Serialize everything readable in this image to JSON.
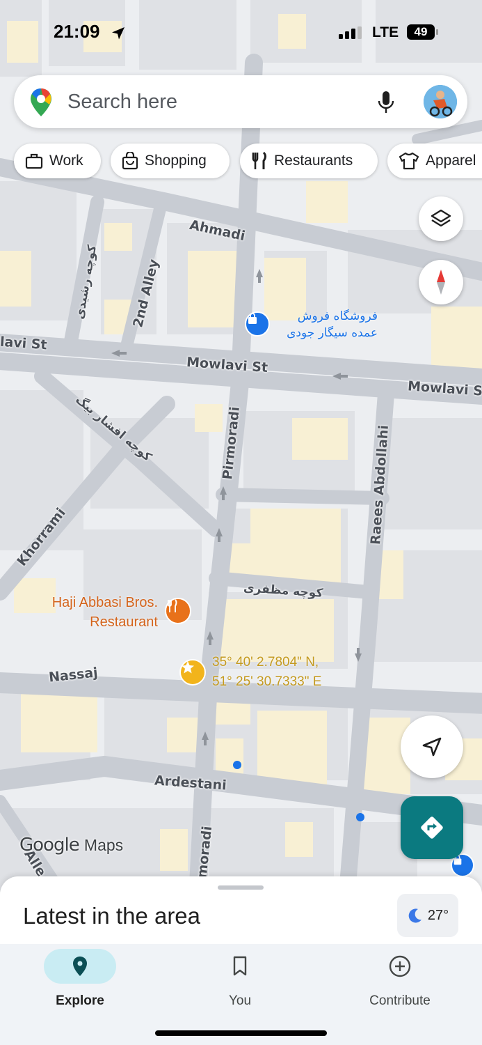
{
  "status_bar": {
    "time": "21:09",
    "carrier": "LTE",
    "battery": "49"
  },
  "search": {
    "placeholder": "Search here"
  },
  "chips": [
    {
      "label": "Work",
      "icon": "briefcase-icon"
    },
    {
      "label": "Shopping",
      "icon": "shopping-bag-icon"
    },
    {
      "label": "Restaurants",
      "icon": "fork-knife-icon"
    },
    {
      "label": "Apparel",
      "icon": "shirt-icon"
    }
  ],
  "map": {
    "streets": [
      "Ahmadi",
      "Mowlavi St",
      "Mowlavi St",
      "Mowlavi S",
      "lavi St",
      "2nd Alley",
      "کوچه رشیدی",
      "کوچه افشار بیگ",
      "Pirmoradi",
      "Raees Abdollahi",
      "Khorrami",
      "کوچه مظفری",
      "Nassaj",
      "Ardestani",
      "irmoradi",
      "Alle"
    ],
    "pois": [
      {
        "name": "فروشگاه فروش عمده سیگار جودی",
        "type": "shopping",
        "color": "#1a73e8"
      },
      {
        "name": "Haji Abbasi Bros. Restaurant",
        "type": "restaurant",
        "color": "#e8711a"
      }
    ],
    "pin": {
      "line1": "35° 40' 2.7804\" N,",
      "line2": "51° 25' 30.7333\" E"
    },
    "attribution_google": "Google",
    "attribution_maps": "Maps"
  },
  "sheet": {
    "title": "Latest in the area",
    "temperature": "27°"
  },
  "nav": [
    {
      "label": "Explore",
      "active": true
    },
    {
      "label": "You",
      "active": false
    },
    {
      "label": "Contribute",
      "active": false
    }
  ],
  "colors": {
    "accent": "#0b7a80",
    "explore_pill": "#c9ecf3",
    "poi_blue": "#1a73e8",
    "poi_orange": "#e8711a",
    "pin_gold": "#f2b41b"
  }
}
